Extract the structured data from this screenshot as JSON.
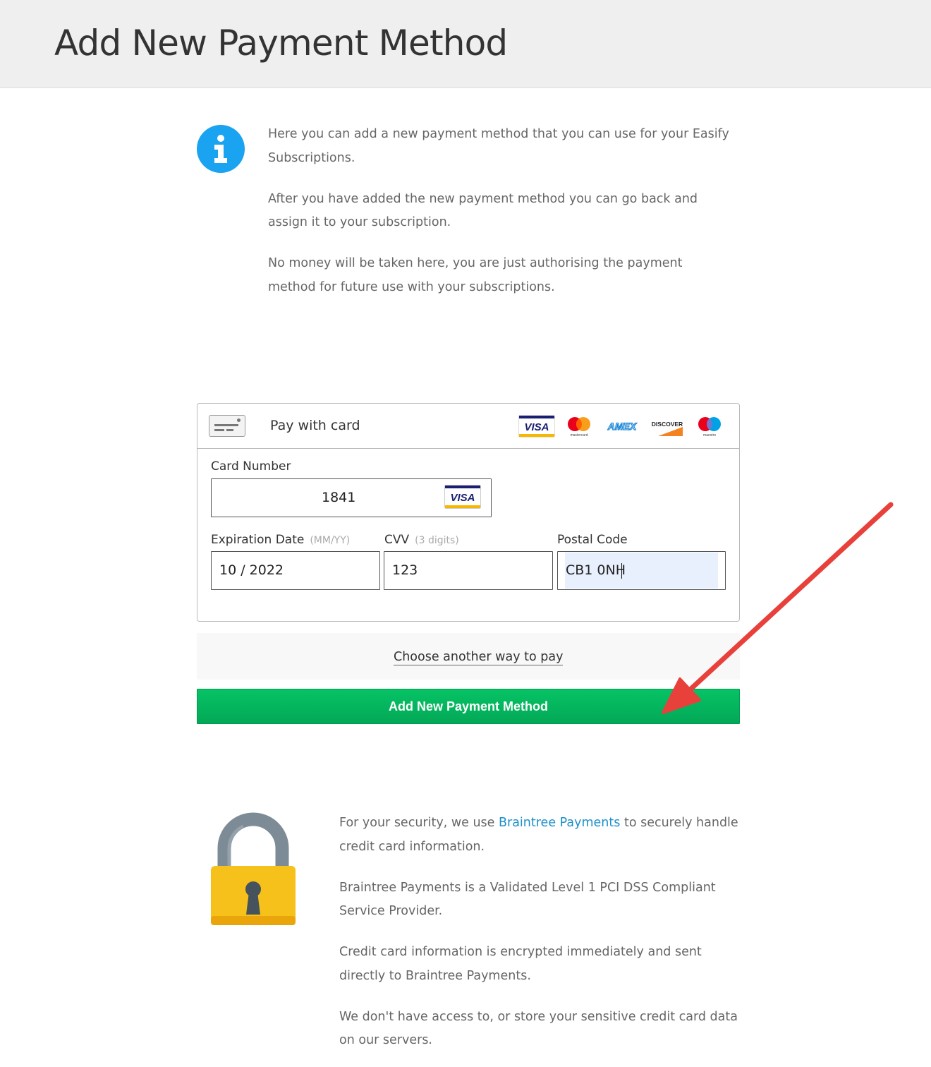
{
  "page_title": "Add New Payment Method",
  "info": {
    "paragraphs": [
      "Here you can add a new payment method that you can use for your Easify Subscriptions.",
      "After you have added the new payment method you can go back and assign it to your subscription.",
      "No money will be taken here, you are just authorising the payment method for future use with your subscriptions."
    ]
  },
  "card_form": {
    "title": "Pay with card",
    "brands": [
      "VISA",
      "mastercard",
      "AMEX",
      "DISCOVER",
      "maestro"
    ],
    "card_number": {
      "label": "Card Number",
      "value": "1841",
      "brand": "VISA"
    },
    "expiration": {
      "label": "Expiration Date",
      "hint": "(MM/YY)",
      "value": "10 / 2022"
    },
    "cvv": {
      "label": "CVV",
      "hint": "(3 digits)",
      "value": "123"
    },
    "postal": {
      "label": "Postal Code",
      "value": "CB1 0NH"
    }
  },
  "alt_pay_label": "Choose another way to pay",
  "submit_label": "Add New Payment Method",
  "security": {
    "p1_before": "For your security, we use ",
    "p1_link": "Braintree Payments",
    "p1_after": " to securely handle credit card information.",
    "p2": "Braintree Payments is a Validated Level 1 PCI DSS Compliant Service Provider.",
    "p3": "Credit card information is encrypted immediately and sent directly to Braintree Payments.",
    "p4": "We don't have access to, or store your sensitive credit card data on our servers."
  },
  "colors": {
    "header_bg": "#efefef",
    "info_icon": "#1aa3f1",
    "submit_green": "#03b35e",
    "link_blue": "#1d8fca",
    "arrow_red": "#e8403a",
    "postal_highlight": "#e8f0fe"
  }
}
